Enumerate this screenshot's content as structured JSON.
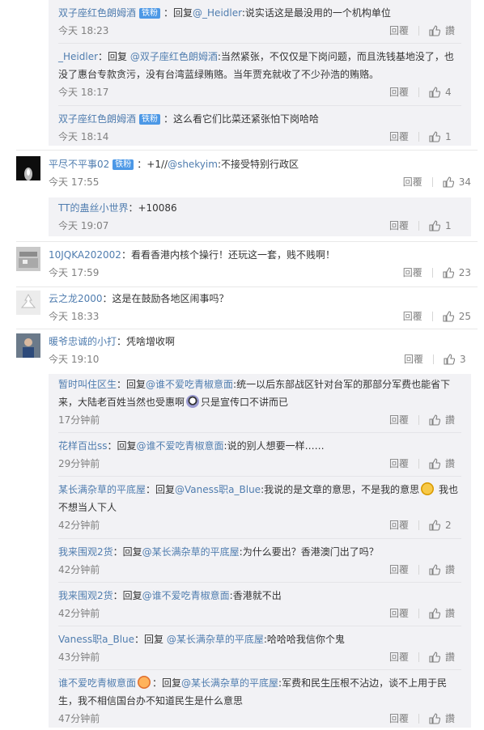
{
  "actions": {
    "reply_label": "回覆",
    "like_icon": "thumbs-up-icon"
  },
  "badge_label": "铁粉",
  "top_replies": [
    {
      "user": "双子座红色朗姆酒",
      "badge": true,
      "prefix": "：回复",
      "mention": "@_Heidler",
      "text": ":说实话这是最没用的一个机构单位",
      "time": "今天 18:23",
      "likes": "讚"
    },
    {
      "user": "_Heidler",
      "badge": false,
      "prefix": "：回复 ",
      "mention": "@双子座红色朗姆酒",
      "text": ":当然紧张，不仅仅是下岗问题，而且洗钱基地没了，也没了惠台专款贪污，没有台湾蓝绿贿赂。当年贾充就收了不少孙浩的贿赂。",
      "time": "今天 18:17",
      "likes": "4"
    },
    {
      "user": "双子座红色朗姆酒",
      "badge": true,
      "prefix": "：这么看它们比菜还紧张怕下岗哈哈",
      "mention": "",
      "text": "",
      "time": "今天 18:14",
      "likes": "1"
    }
  ],
  "comments": [
    {
      "user": "平尽不平事02",
      "badge": true,
      "text_before": "：+1//",
      "mention": "@shekyim",
      "text_after": ":不接受特别行政区",
      "time": "今天 17:55",
      "likes": "34"
    },
    {
      "user": "10JQKA202002",
      "badge": false,
      "text_before": "：看看香港内核个操行！还玩这一套，贱不贱啊！",
      "mention": "",
      "text_after": "",
      "time": "今天 17:59",
      "likes": "23"
    },
    {
      "user": "云之龙2000",
      "badge": false,
      "text_before": "：这是在鼓励各地区闹事吗？",
      "mention": "",
      "text_after": "",
      "time": "今天 18:33",
      "likes": "25"
    },
    {
      "user": "暖爷忠诚的小打",
      "badge": false,
      "text_before": "：凭啥增收啊",
      "mention": "",
      "text_after": "",
      "time": "今天 19:10",
      "likes": "3"
    }
  ],
  "mid_reply": {
    "user": "TT的蛊丝小世界",
    "text": "：+10086",
    "time": "今天 19:07",
    "likes": "1"
  },
  "bottom_replies": [
    {
      "user": "暂时叫住区生",
      "prefix": "：回复",
      "mention": "@谁不爱吃青椒意面",
      "text": ":统一以后东部战区针对台军的那部分军费也能省下来，大陆老百姓当然也受惠啊",
      "emoji": "a",
      "text2": "只是宣传口不讲而已",
      "time": "17分钟前",
      "likes": "讚"
    },
    {
      "user": "花样百出ss",
      "prefix": "：回复",
      "mention": "@谁不爱吃青椒意面",
      "text": ":说的别人想要一样……",
      "emoji": "",
      "text2": "",
      "time": "29分钟前",
      "likes": "讚"
    },
    {
      "user": "某长满杂草的平底屋",
      "prefix": "：回复",
      "mention": "@Vaness职a_Blue",
      "text": ":我说的是文章的意思，不是我的意思",
      "emoji": "b",
      "text2": " 我也不想当人下人",
      "time": "42分钟前",
      "likes": "2"
    },
    {
      "user": "我来围观2货",
      "prefix": "：回复",
      "mention": "@某长满杂草的平底屋",
      "text": ":为什么要出？香港澳门出了吗？",
      "emoji": "",
      "text2": "",
      "time": "42分钟前",
      "likes": "讚"
    },
    {
      "user": "我来围观2货",
      "prefix": "：回复",
      "mention": "@谁不爱吃青椒意面",
      "text": ":香港就不出",
      "emoji": "",
      "text2": "",
      "time": "42分钟前",
      "likes": "讚"
    },
    {
      "user": "Vaness职a_Blue",
      "prefix": "：回复 ",
      "mention": "@某长满杂草的平底屋",
      "text": ":哈哈哈我信你个鬼",
      "emoji": "",
      "text2": "",
      "time": "43分钟前",
      "likes": "讚"
    },
    {
      "user": "谁不爱吃青椒意面",
      "prefix": "：回复",
      "mention": "@某长满杂草的平底屋",
      "text": ":军费和民生压根不沾边，谈不上用于民生，我不相信国台办不知道民生是什么意思",
      "emoji": "c",
      "emoji_after_user": true,
      "text2": "",
      "time": "47分钟前",
      "likes": "讚"
    }
  ]
}
